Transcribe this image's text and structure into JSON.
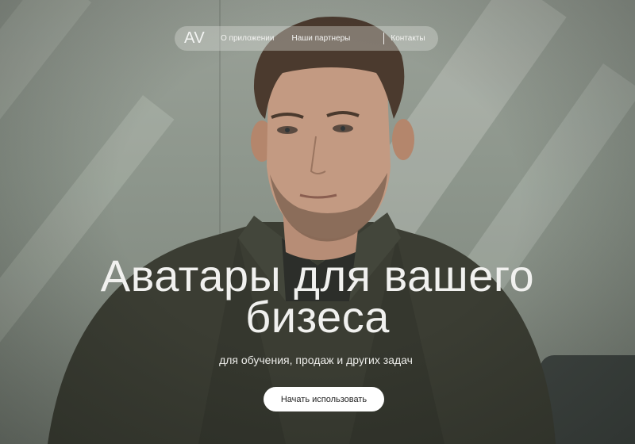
{
  "nav": {
    "logo": "AV",
    "items": [
      {
        "label": "О приложении"
      },
      {
        "label": "Наши партнеры"
      }
    ],
    "contacts_label": "Контакты"
  },
  "hero": {
    "headline_line1": "Аватары для вашего",
    "headline_line2": "бизеса",
    "subtitle": "для обучения, продаж и других задач",
    "cta_label": "Начать использовать"
  },
  "colors": {
    "background": "#8d968c",
    "nav_pill": "#dce0da",
    "text": "#f1f1ef",
    "cta_bg": "#ffffff",
    "cta_text": "#222222",
    "jacket": "#3b3d33"
  }
}
